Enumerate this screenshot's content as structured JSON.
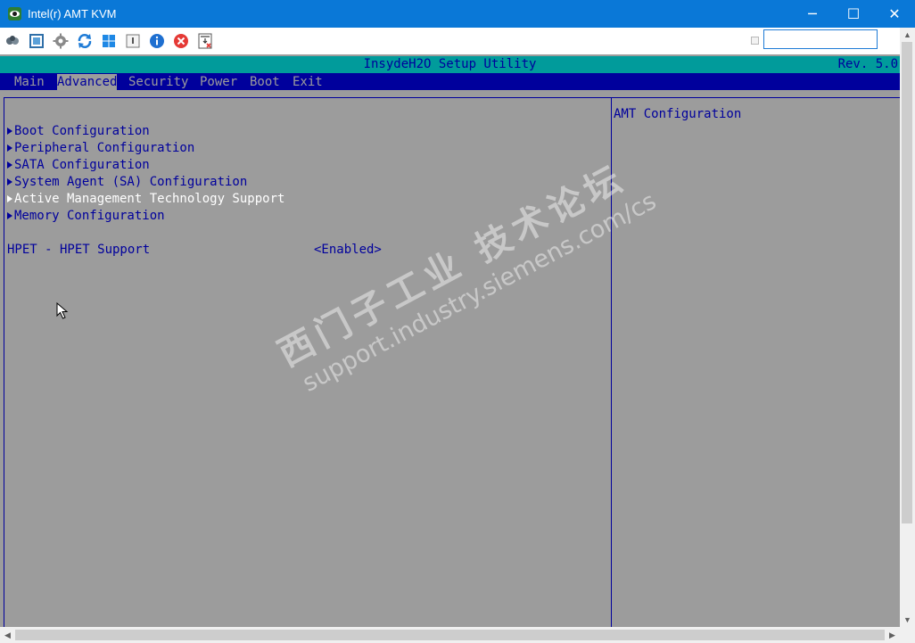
{
  "window": {
    "title": "Intel(r) AMT KVM",
    "minimize_glyph": "─",
    "maximize_glyph": "☐",
    "close_glyph": "✕"
  },
  "toolbar": {
    "icons": [
      "connect-icon",
      "fullscreen-icon",
      "settings-icon",
      "refresh-icon",
      "windows-key-icon",
      "document-icon",
      "info-icon",
      "disconnect-icon",
      "ctrl-alt-del-icon"
    ],
    "search_value": ""
  },
  "bios": {
    "title": "InsydeH2O Setup Utility",
    "revision": "Rev. 5.0",
    "tabs": [
      {
        "label": "Main",
        "active": false
      },
      {
        "label": "Advanced",
        "active": true
      },
      {
        "label": "Security",
        "active": false
      },
      {
        "label": "Power",
        "active": false
      },
      {
        "label": "Boot",
        "active": false
      },
      {
        "label": "Exit",
        "active": false
      }
    ],
    "menu_items": [
      {
        "label": "Boot Configuration",
        "selected": false
      },
      {
        "label": "Peripheral Configuration",
        "selected": false
      },
      {
        "label": "SATA Configuration",
        "selected": false
      },
      {
        "label": "System Agent (SA) Configuration",
        "selected": false
      },
      {
        "label": "Active Management Technology Support",
        "selected": true
      },
      {
        "label": "Memory Configuration",
        "selected": false
      }
    ],
    "settings": [
      {
        "label": "HPET - HPET Support",
        "value": "<Enabled>"
      }
    ],
    "help_text": "AMT Configuration"
  },
  "watermark": {
    "chinese": "西门子工业 技术论坛",
    "url": "support.industry.siemens.com/cs"
  },
  "colors": {
    "titlebar": "#0a78d7",
    "bios_background": "#9c9c9c",
    "bios_blue": "#00009c",
    "bios_header": "#019b9b"
  }
}
